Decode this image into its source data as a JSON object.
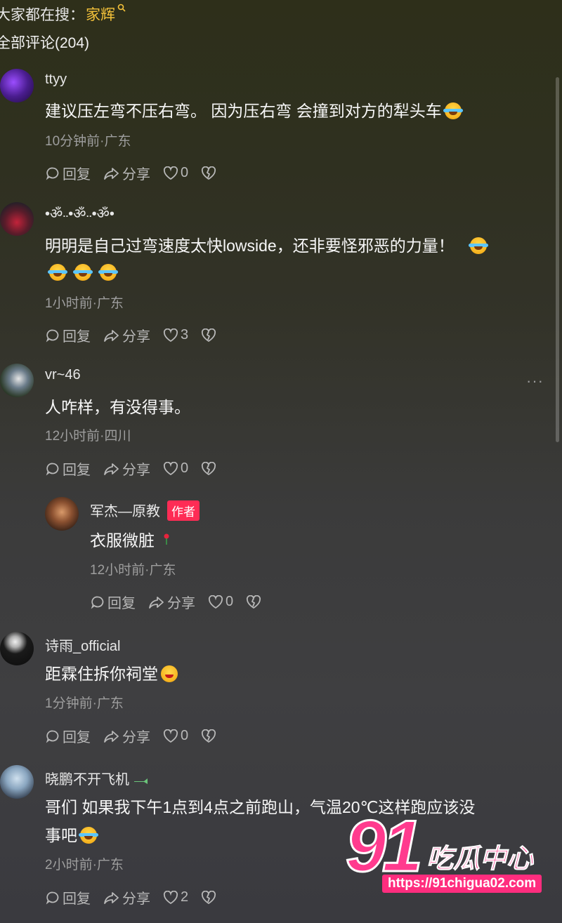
{
  "header": {
    "search_prefix": "大家都在搜：",
    "search_keyword": "家辉",
    "search_icon": "search-icon",
    "comment_count_label": "全部评论(204)"
  },
  "comments": [
    {
      "user": "ttyy",
      "text": "建议压左弯不压右弯。 因为压右弯 会撞到对方的犁头车",
      "emojis": [
        "laugh-cry"
      ],
      "meta": "10分钟前·广东",
      "reply_label": "回复",
      "share_label": "分享",
      "likes": "0"
    },
    {
      "user": "•ॐ܁܁•ॐ܁܁•ॐ•",
      "text": "明明是自己过弯速度太快lowside，还非要怪邪恶的力量！",
      "emojis": [
        "laugh-cry",
        "laugh-cry",
        "laugh-cry",
        "laugh-cry"
      ],
      "meta": "1小时前·广东",
      "reply_label": "回复",
      "share_label": "分享",
      "likes": "3"
    },
    {
      "user": "vr~46",
      "text": "人咋样，有没得事。",
      "meta": "12小时前·四川",
      "reply_label": "回复",
      "share_label": "分享",
      "likes": "0",
      "more": "···",
      "reply": {
        "user": "军杰—原教",
        "tag": "作者",
        "text": "衣服微脏",
        "emojis": [
          "rose"
        ],
        "meta": "12小时前·广东",
        "reply_label": "回复",
        "share_label": "分享",
        "likes": "0"
      }
    },
    {
      "user": "诗雨_official",
      "text": "距霖住拆你祠堂",
      "emojis": [
        "grin"
      ],
      "meta": "1分钟前·广东",
      "reply_label": "回复",
      "share_label": "分享",
      "likes": "0"
    },
    {
      "user": "晓鹏不开飞机",
      "text_line1": "哥们 如果我下午1点到4点之前跑山，气温20℃这样跑应该没",
      "text_line2": "事吧",
      "emojis": [
        "fearful"
      ],
      "meta": "2小时前·广东",
      "reply_label": "回复",
      "share_label": "分享",
      "likes": "2"
    }
  ],
  "watermark": {
    "number": "91",
    "name": "吃瓜中心",
    "url": "https://91chigua02.com"
  },
  "colors": {
    "keyword": "#f4c23a",
    "author_tag": "#fe2c55",
    "watermark": "#ff3b8e"
  }
}
